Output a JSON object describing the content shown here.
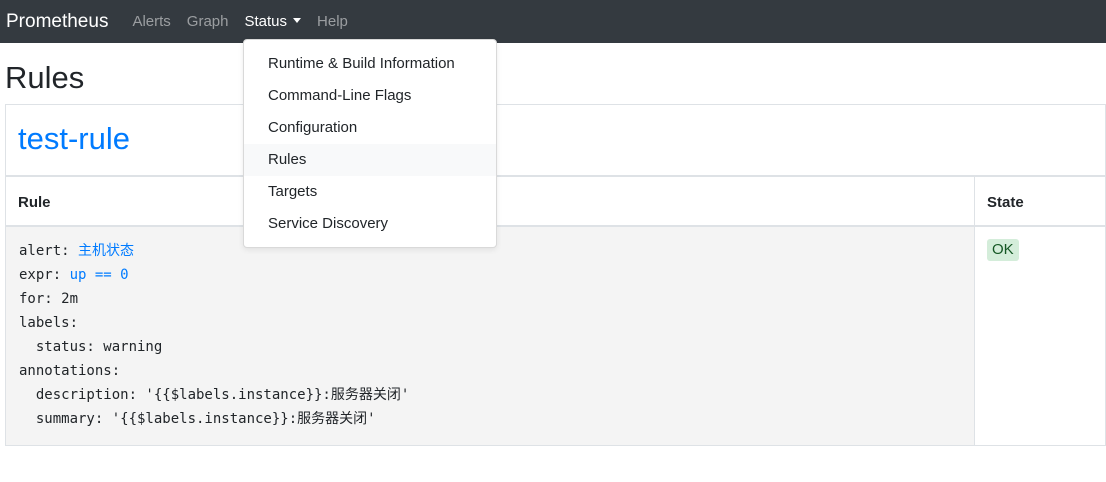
{
  "navbar": {
    "brand": "Prometheus",
    "links": [
      {
        "label": "Alerts"
      },
      {
        "label": "Graph"
      },
      {
        "label": "Status"
      },
      {
        "label": "Help"
      }
    ]
  },
  "dropdown": {
    "items": [
      {
        "label": "Runtime & Build Information"
      },
      {
        "label": "Command-Line Flags"
      },
      {
        "label": "Configuration"
      },
      {
        "label": "Rules"
      },
      {
        "label": "Targets"
      },
      {
        "label": "Service Discovery"
      }
    ]
  },
  "page": {
    "title": "Rules"
  },
  "group": {
    "name": "test-rule",
    "headers": {
      "rule": "Rule",
      "state": "State"
    },
    "rule": {
      "alert_key": "alert: ",
      "alert_value": "主机状态",
      "expr_key": "expr: ",
      "expr_value": "up == 0",
      "for_line": "for: 2m",
      "labels_line": "labels:",
      "status_line": "  status: warning",
      "annotations_line": "annotations:",
      "description_line": "  description: '{{$labels.instance}}:服务器关闭'",
      "summary_line": "  summary: '{{$labels.instance}}:服务器关闭'"
    },
    "state": "OK"
  },
  "colors": {
    "navbar_bg": "#343a40",
    "link_blue": "#007bff",
    "ok_badge_bg": "#d4edda",
    "ok_badge_text": "#155724"
  }
}
